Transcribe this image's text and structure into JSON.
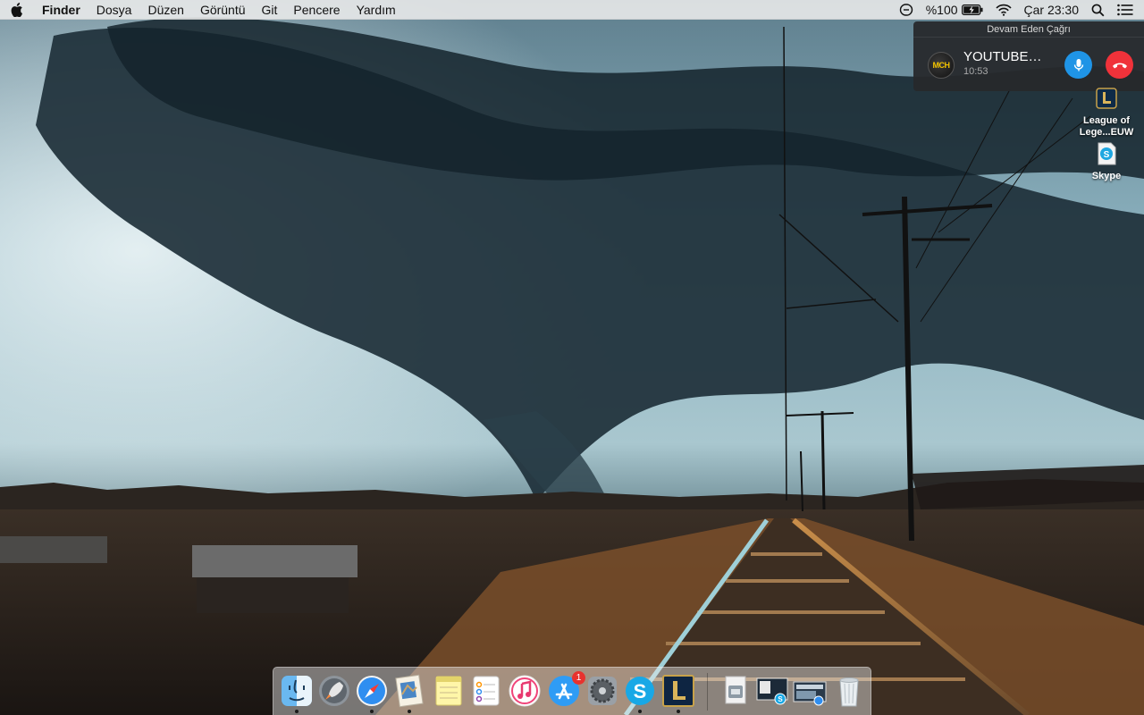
{
  "menubar": {
    "app_name": "Finder",
    "items": [
      "Dosya",
      "Düzen",
      "Görüntü",
      "Git",
      "Pencere",
      "Yardım"
    ],
    "battery": "%100",
    "clock": "Çar 23:30"
  },
  "call": {
    "header": "Devam Eden Çağrı",
    "avatar_text": "MCH",
    "caller": "YOUTUBE…",
    "duration": "10:53",
    "mute_color": "#1f94e6",
    "hangup_color": "#f0323a"
  },
  "desktop_icons": [
    {
      "label_line1": "League of",
      "label_line2": "Lege...EUW",
      "icon": "league-of-legends-icon"
    },
    {
      "label_line1": "Skype",
      "icon": "skype-icon"
    }
  ],
  "dock": {
    "badge_app_store": "1",
    "apps": [
      "finder-icon",
      "launchpad-icon",
      "safari-icon",
      "mail-icon",
      "notes-icon",
      "reminders-icon",
      "itunes-icon",
      "app-store-icon",
      "system-preferences-icon",
      "skype-icon",
      "league-of-legends-icon"
    ],
    "stacks": [
      "downloads-stack-icon",
      "screenshot-stack-icon",
      "documents-stack-icon",
      "trash-icon"
    ]
  }
}
